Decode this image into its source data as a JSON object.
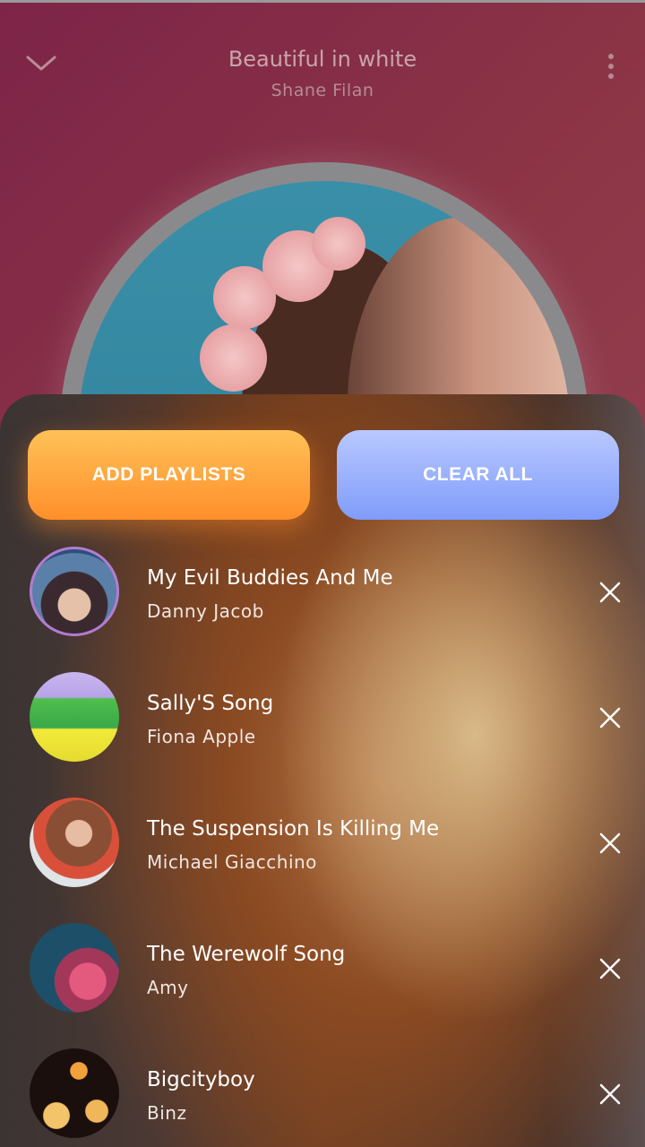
{
  "now_playing": {
    "title": "Beautiful in white",
    "artist": "Shane Filan"
  },
  "actions": {
    "add_playlists_label": "ADD PLAYLISTS",
    "clear_all_label": "CLEAR ALL"
  },
  "queue": [
    {
      "title": "My Evil Buddies And Me",
      "artist": "Danny Jacob"
    },
    {
      "title": "Sally'S Song",
      "artist": "Fiona Apple"
    },
    {
      "title": "The Suspension Is Killing Me",
      "artist": "Michael Giacchino"
    },
    {
      "title": "The Werewolf Song",
      "artist": "Amy"
    },
    {
      "title": "Bigcityboy",
      "artist": "Binz"
    }
  ],
  "icons": {
    "back": "chevron-down-icon",
    "more": "more-vertical-icon",
    "remove": "close-icon"
  },
  "colors": {
    "add_button": "#ff9a30",
    "clear_button": "#8fa8fc",
    "header_background": "#8a2c47"
  }
}
